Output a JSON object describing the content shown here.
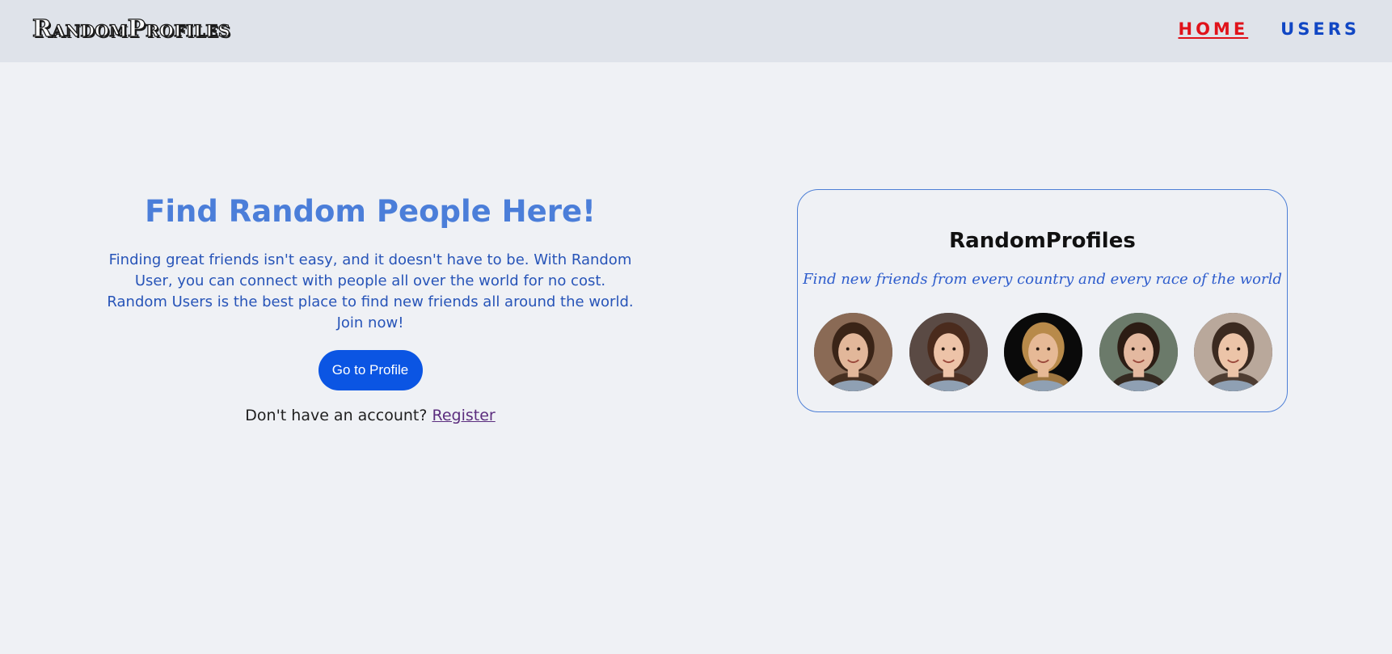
{
  "header": {
    "logo": "RandomProfiles",
    "nav": [
      {
        "label": "HOME",
        "active": true
      },
      {
        "label": "USERS",
        "active": false
      }
    ]
  },
  "hero": {
    "title": "Find Random People Here!",
    "text": "Finding great friends isn't easy, and it doesn't have to be. With Random User, you can connect with people all over the world for no cost. Random Users is the best place to find new friends all around the world. Join now!",
    "button": "Go to Profile",
    "signup_prompt": "Don't have an account?",
    "signup_link": "Register"
  },
  "card": {
    "title": "RandomProfiles",
    "subtitle": "Find new friends from every country and every race of the world",
    "avatars": [
      {
        "name": "avatar-woman-1",
        "bg": "#8a6a55",
        "skin": "#e2b79a",
        "hair": "#3a2417"
      },
      {
        "name": "avatar-woman-2",
        "bg": "#5a4a44",
        "skin": "#edc3a8",
        "hair": "#4a2b1d"
      },
      {
        "name": "avatar-man-1",
        "bg": "#0a0a0a",
        "skin": "#e6b996",
        "hair": "#b88a4a"
      },
      {
        "name": "avatar-woman-3",
        "bg": "#6b7a6a",
        "skin": "#e4b9a0",
        "hair": "#2c1c14"
      },
      {
        "name": "avatar-man-2",
        "bg": "#b9a89b",
        "skin": "#ecc4a8",
        "hair": "#3b2a20"
      }
    ]
  },
  "colors": {
    "accent": "#4b7ed9",
    "button": "#0b55e3",
    "nav_active": "#e0121a",
    "nav": "#1147c4"
  }
}
